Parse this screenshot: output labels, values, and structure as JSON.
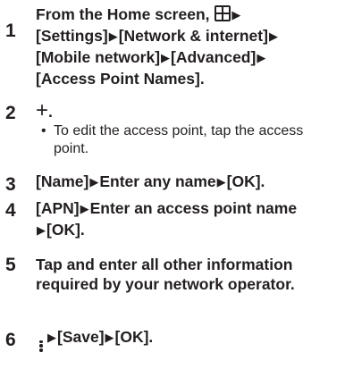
{
  "steps": [
    {
      "num": "1",
      "lead": "From the Home screen, ",
      "parts": [
        "[Settings]",
        "[Network & internet]",
        "[Mobile network]",
        "[Advanced]",
        "[Access Point Names]."
      ]
    },
    {
      "num": "2",
      "after_icon": ".",
      "note": "To edit the access point, tap the access point."
    },
    {
      "num": "3",
      "parts": [
        "[Name]",
        "Enter any name",
        "[OK]."
      ]
    },
    {
      "num": "4",
      "parts": [
        "[APN]",
        "Enter an access point name",
        "[OK]."
      ]
    },
    {
      "num": "5",
      "text": "Tap and enter all other information required by your network operator."
    },
    {
      "num": "6",
      "parts": [
        "[Save]",
        "[OK]."
      ]
    }
  ],
  "glyphs": {
    "arrow": "▶",
    "plus": "+",
    "bullet": "•"
  }
}
